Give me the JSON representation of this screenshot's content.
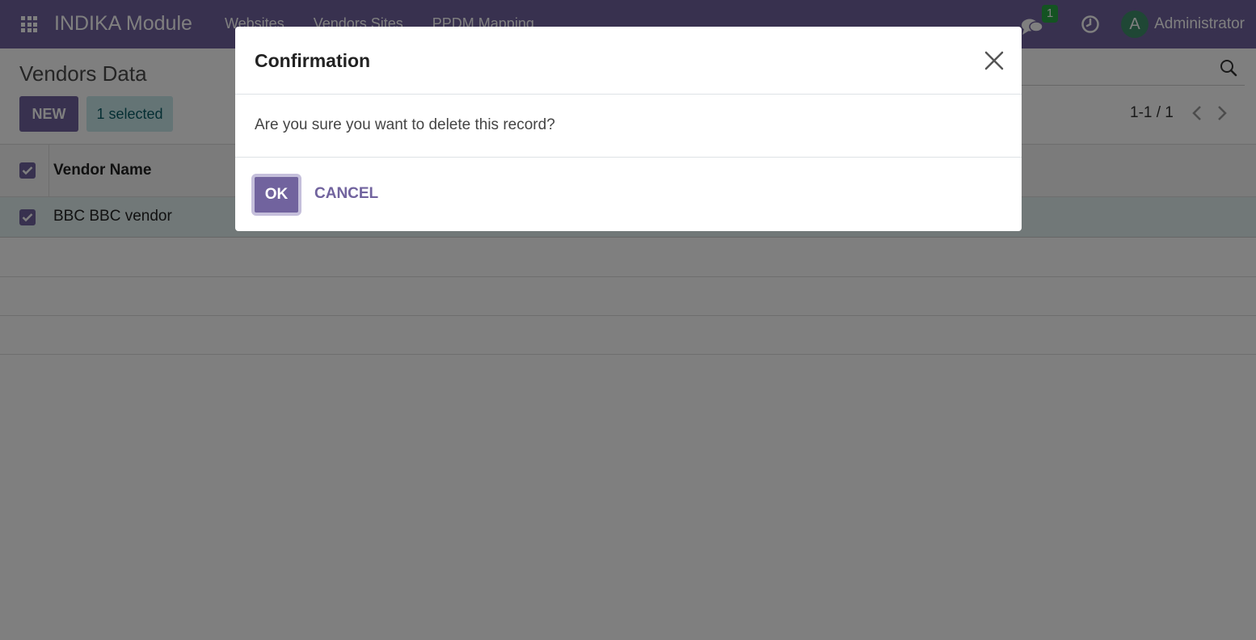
{
  "navbar": {
    "brand": "INDIKA Module",
    "menu": [
      "Websites",
      "Vendors Sites",
      "PPDM Mapping"
    ],
    "messages_count": "1",
    "user_initial": "A",
    "user_name": "Administrator",
    "icons": {
      "apps": "apps-grid-icon",
      "messages": "chat-icon",
      "activity": "clock-icon"
    }
  },
  "control_panel": {
    "title": "Vendors Data",
    "new_button": "NEW",
    "selected_badge": "1 selected",
    "pager": "1-1 / 1"
  },
  "list": {
    "columns": [
      "Vendor Name"
    ],
    "rows": [
      {
        "vendor_name": "BBC BBC vendor",
        "checked": true
      }
    ]
  },
  "dialog": {
    "title": "Confirmation",
    "message": "Are you sure you want to delete this record?",
    "ok_label": "OK",
    "cancel_label": "CANCEL"
  },
  "colors": {
    "brand": "#71639e",
    "badge_green": "#28a745",
    "selected_bg": "#c9e8ea",
    "row_selected_bg": "#e2f0f0"
  }
}
